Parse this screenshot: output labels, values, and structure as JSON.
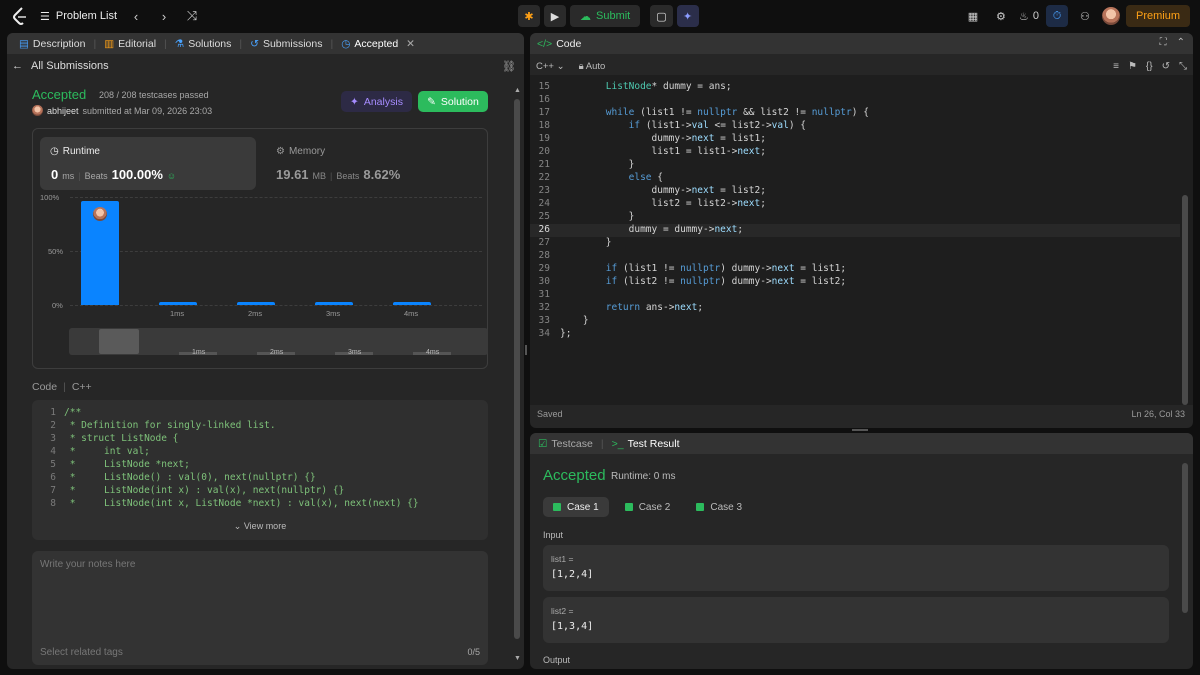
{
  "topbar": {
    "problem_list": "Problem List",
    "submit": "Submit",
    "streak": "0",
    "premium": "Premium"
  },
  "tabs": [
    {
      "label": "Description"
    },
    {
      "label": "Editorial"
    },
    {
      "label": "Solutions"
    },
    {
      "label": "Submissions"
    },
    {
      "label": "Accepted"
    }
  ],
  "sub": {
    "back": "All Submissions",
    "status": "Accepted",
    "tests": "208 / 208 testcases passed",
    "user": "abhijeet",
    "submitted": "submitted at Mar 09, 2026 23:03",
    "analysis": "Analysis",
    "solution": "Solution"
  },
  "runtime": {
    "label": "Runtime",
    "value": "0",
    "unit": "ms",
    "beats_label": "Beats",
    "beats": "100.00%"
  },
  "memory": {
    "label": "Memory",
    "value": "19.61",
    "unit": "MB",
    "beats_label": "Beats",
    "beats": "8.62%"
  },
  "chart_data": {
    "type": "bar",
    "categories": [
      "0ms",
      "1ms",
      "2ms",
      "3ms",
      "4ms"
    ],
    "values": [
      96,
      3,
      3,
      3,
      3
    ],
    "ylabel": "",
    "yticks": [
      "100%",
      "50%",
      "0%"
    ],
    "ylim": [
      0,
      100
    ],
    "xtick_labels": [
      "",
      "1ms",
      "2ms",
      "3ms",
      "4ms"
    ],
    "brush_labels": [
      "1ms",
      "2ms",
      "3ms",
      "4ms"
    ]
  },
  "code_section": {
    "label": "Code",
    "lang": "C++",
    "view_more": "View more",
    "lines": [
      {
        "n": "1",
        "t": "/**"
      },
      {
        "n": "2",
        "t": " * Definition for singly-linked list."
      },
      {
        "n": "3",
        "t": " * struct ListNode {"
      },
      {
        "n": "4",
        "t": " *     int val;"
      },
      {
        "n": "5",
        "t": " *     ListNode *next;"
      },
      {
        "n": "6",
        "t": " *     ListNode() : val(0), next(nullptr) {}"
      },
      {
        "n": "7",
        "t": " *     ListNode(int x) : val(x), next(nullptr) {}"
      },
      {
        "n": "8",
        "t": " *     ListNode(int x, ListNode *next) : val(x), next(next) {}"
      }
    ]
  },
  "notes": {
    "placeholder": "Write your notes here",
    "tags": "Select related tags",
    "count": "0/5"
  },
  "editor": {
    "title": "Code",
    "lang": "C++",
    "mode": "Auto",
    "saved": "Saved",
    "cursor": "Ln 26, Col 33",
    "lines": [
      {
        "n": "15",
        "t": "        ListNode* dummy = ans;"
      },
      {
        "n": "16",
        "t": ""
      },
      {
        "n": "17",
        "t": "        while (list1 != nullptr && list2 != nullptr) {"
      },
      {
        "n": "18",
        "t": "            if (list1->val <= list2->val) {"
      },
      {
        "n": "19",
        "t": "                dummy->next = list1;"
      },
      {
        "n": "20",
        "t": "                list1 = list1->next;"
      },
      {
        "n": "21",
        "t": "            }"
      },
      {
        "n": "22",
        "t": "            else {"
      },
      {
        "n": "23",
        "t": "                dummy->next = list2;"
      },
      {
        "n": "24",
        "t": "                list2 = list2->next;"
      },
      {
        "n": "25",
        "t": "            }"
      },
      {
        "n": "26",
        "t": "            dummy = dummy->next;"
      },
      {
        "n": "27",
        "t": "        }"
      },
      {
        "n": "28",
        "t": ""
      },
      {
        "n": "29",
        "t": "        if (list1 != nullptr) dummy->next = list1;"
      },
      {
        "n": "30",
        "t": "        if (list2 != nullptr) dummy->next = list2;"
      },
      {
        "n": "31",
        "t": ""
      },
      {
        "n": "32",
        "t": "        return ans->next;"
      },
      {
        "n": "33",
        "t": "    }"
      },
      {
        "n": "34",
        "t": "};"
      }
    ]
  },
  "result": {
    "testcase_tab": "Testcase",
    "result_tab": "Test Result",
    "status": "Accepted",
    "runtime": "Runtime: 0 ms",
    "cases": [
      "Case 1",
      "Case 2",
      "Case 3"
    ],
    "input_label": "Input",
    "output_label": "Output",
    "inputs": [
      {
        "label": "list1 =",
        "value": "[1,2,4]"
      },
      {
        "label": "list2 =",
        "value": "[1,3,4]"
      }
    ]
  }
}
